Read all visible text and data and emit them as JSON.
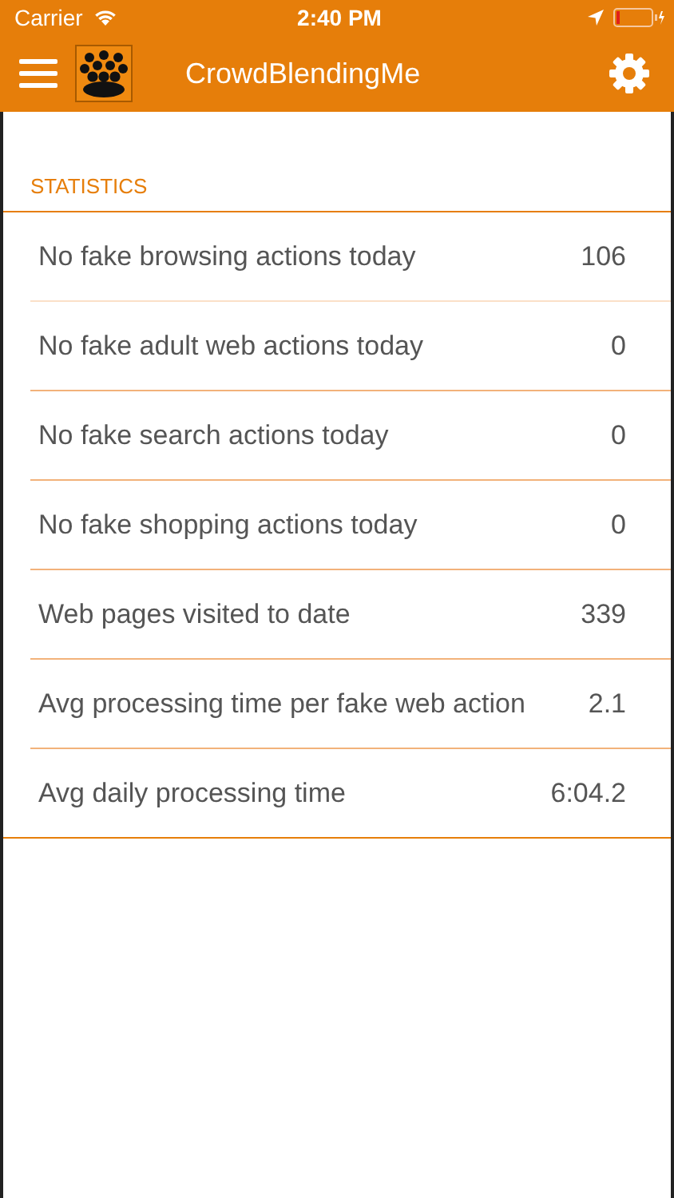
{
  "status_bar": {
    "carrier": "Carrier",
    "time": "2:40 PM"
  },
  "nav_bar": {
    "title": "CrowdBlendingMe"
  },
  "section": {
    "header": "STATISTICS",
    "rows": [
      {
        "label": "No fake browsing actions today",
        "value": "106"
      },
      {
        "label": "No fake adult web actions today",
        "value": "0"
      },
      {
        "label": "No fake search actions today",
        "value": "0"
      },
      {
        "label": "No fake shopping actions today",
        "value": "0"
      },
      {
        "label": "Web pages visited to date",
        "value": "339"
      },
      {
        "label": "Avg processing time per fake web action",
        "value": "2.1"
      },
      {
        "label": "Avg daily processing time",
        "value": "6:04.2"
      }
    ]
  }
}
